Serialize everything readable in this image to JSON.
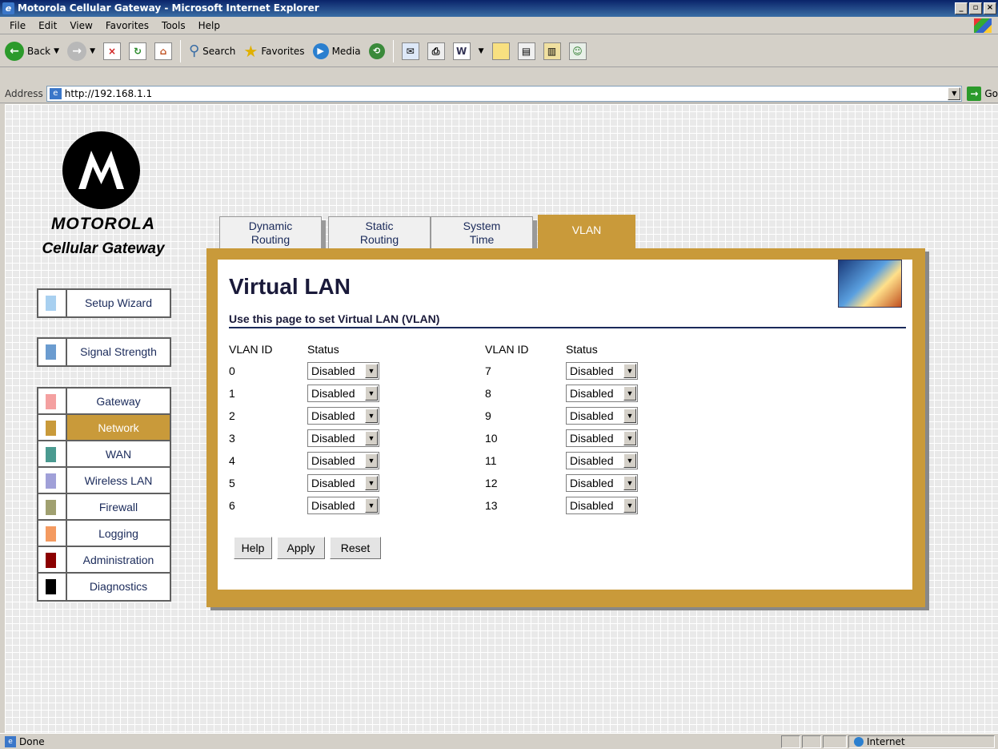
{
  "window": {
    "title": "Motorola Cellular Gateway - Microsoft Internet Explorer"
  },
  "menu": {
    "file": "File",
    "edit": "Edit",
    "view": "View",
    "favorites": "Favorites",
    "tools": "Tools",
    "help": "Help"
  },
  "toolbar": {
    "back": "Back",
    "search": "Search",
    "favorites": "Favorites",
    "media": "Media"
  },
  "address": {
    "label": "Address",
    "url": "http://192.168.1.1",
    "go": "Go"
  },
  "brand": {
    "name": "MOTOROLA",
    "subtitle": "Cellular Gateway"
  },
  "nav": {
    "setup_wizard": {
      "label": "Setup Wizard",
      "color": "#a8d0f0"
    },
    "signal_strength": {
      "label": "Signal Strength",
      "color": "#6b9cd0"
    },
    "items": [
      {
        "label": "Gateway",
        "color": "#f4a0a0"
      },
      {
        "label": "Network",
        "color": "#c99a3a"
      },
      {
        "label": "WAN",
        "color": "#4a9a90"
      },
      {
        "label": "Wireless LAN",
        "color": "#a0a0d8"
      },
      {
        "label": "Firewall",
        "color": "#a0a070"
      },
      {
        "label": "Logging",
        "color": "#f49a60"
      },
      {
        "label": "Administration",
        "color": "#8b0000"
      },
      {
        "label": "Diagnostics",
        "color": "#000000"
      }
    ],
    "active": "Network"
  },
  "tabs": {
    "dynamic_l1": "Dynamic",
    "dynamic_l2": "Routing",
    "static_l1": "Static",
    "static_l2": "Routing",
    "time_l1": "System",
    "time_l2": "Time",
    "vlan": "VLAN",
    "active": "VLAN"
  },
  "page": {
    "title": "Virtual LAN",
    "subtitle": "Use this page to set Virtual LAN (VLAN)",
    "col_vlan_id": "VLAN ID",
    "col_status": "Status",
    "left": [
      {
        "id": "0",
        "status": "Disabled"
      },
      {
        "id": "1",
        "status": "Disabled"
      },
      {
        "id": "2",
        "status": "Disabled"
      },
      {
        "id": "3",
        "status": "Disabled"
      },
      {
        "id": "4",
        "status": "Disabled"
      },
      {
        "id": "5",
        "status": "Disabled"
      },
      {
        "id": "6",
        "status": "Disabled"
      }
    ],
    "right": [
      {
        "id": "7",
        "status": "Disabled"
      },
      {
        "id": "8",
        "status": "Disabled"
      },
      {
        "id": "9",
        "status": "Disabled"
      },
      {
        "id": "10",
        "status": "Disabled"
      },
      {
        "id": "11",
        "status": "Disabled"
      },
      {
        "id": "12",
        "status": "Disabled"
      },
      {
        "id": "13",
        "status": "Disabled"
      }
    ],
    "help_btn": "Help",
    "apply_btn": "Apply",
    "reset_btn": "Reset"
  },
  "status": {
    "text": "Done",
    "zone": "Internet"
  }
}
